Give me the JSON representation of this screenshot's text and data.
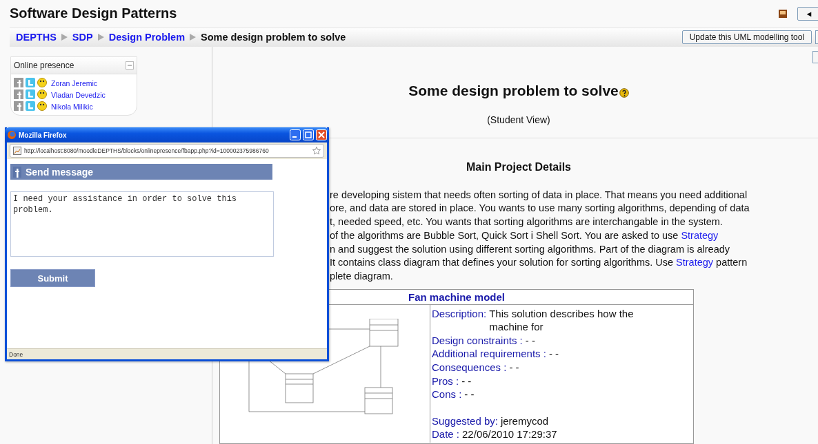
{
  "page_title": "Software Design Patterns",
  "header_buttons": [
    {
      "label": "◄"
    }
  ],
  "breadcrumb": [
    {
      "label": "DEPTHS",
      "kind": "link"
    },
    {
      "label": "SDP",
      "kind": "link"
    },
    {
      "label": "Design Problem",
      "kind": "link"
    },
    {
      "label": "Some design problem to solve",
      "kind": "current"
    }
  ],
  "toolbar_button": "Update this UML modelling tool",
  "online_presence": {
    "title": "Online presence",
    "users": [
      {
        "name": "Zoran Jeremic"
      },
      {
        "name": "Vladan Devedzic"
      },
      {
        "name": "Nikola Milikic"
      }
    ]
  },
  "problem": {
    "title": "Some design problem to solve",
    "view": "(Student View)"
  },
  "details": {
    "heading": "Main Project Details",
    "lines": [
      [
        {
          "kind": "text",
          "text": "re developing sistem that needs often sorting of data in place. That means you need additional"
        }
      ],
      [
        {
          "kind": "text",
          "text": "ore, and data are stored in place. You wants to use many sorting algorithms, depending of data"
        }
      ],
      [
        {
          "kind": "text",
          "text": "t, needed speed, etc. You wants that sorting algorithms are interchangable in the system."
        }
      ],
      [
        {
          "kind": "text",
          "text": "of the algorithms are Bubble Sort, Quick Sort i Shell Sort. You are asked to use"
        },
        {
          "kind": "link",
          "text": "Strategy"
        }
      ],
      [
        {
          "kind": "text",
          "text": "n and suggest the solution using different sorting algorithms. Part of the diagram is already"
        }
      ],
      [
        {
          "kind": "text",
          "text": "It contains class diagram that defines your solution for sorting algorithms. Use"
        },
        {
          "kind": "link",
          "text": "Strategy"
        },
        {
          "kind": "text",
          "text": "pattern"
        }
      ],
      [
        {
          "kind": "text",
          "text": "plete diagram."
        }
      ]
    ]
  },
  "model_table": {
    "title": "Fan machine model",
    "fields": [
      [
        {
          "kind": "term",
          "text": "Description:"
        },
        {
          "kind": "plain",
          "text": "This solution describes how the machine for"
        }
      ],
      [
        {
          "kind": "term",
          "text": "Design constraints :"
        },
        {
          "kind": "plain",
          "text": "- -"
        }
      ],
      [
        {
          "kind": "term",
          "text": "Additional requirements :"
        },
        {
          "kind": "plain",
          "text": "- -"
        }
      ],
      [
        {
          "kind": "term",
          "text": "Consequences :"
        },
        {
          "kind": "plain",
          "text": "- -"
        }
      ],
      [
        {
          "kind": "term",
          "text": "Pros :"
        },
        {
          "kind": "plain",
          "text": "- -"
        }
      ],
      [
        {
          "kind": "term",
          "text": "Cons :"
        },
        {
          "kind": "plain",
          "text": "- -"
        }
      ]
    ],
    "meta": [
      [
        {
          "kind": "term",
          "text": "Suggested by:"
        },
        {
          "kind": "plain",
          "text": "jeremycod"
        }
      ],
      [
        {
          "kind": "term",
          "text": "Date :"
        },
        {
          "kind": "plain",
          "text": "22/06/2010 17:29:37"
        }
      ]
    ]
  },
  "popup": {
    "title": "Mozilla Firefox",
    "url": "http://localhost:8080/moodleDEPTHS/blocks/onlinepresence/fbapp.php?id=100002375986760",
    "heading": "Send message",
    "message": "I need your assistance in order to solve this problem.",
    "submit": "Submit",
    "status": "Done"
  }
}
